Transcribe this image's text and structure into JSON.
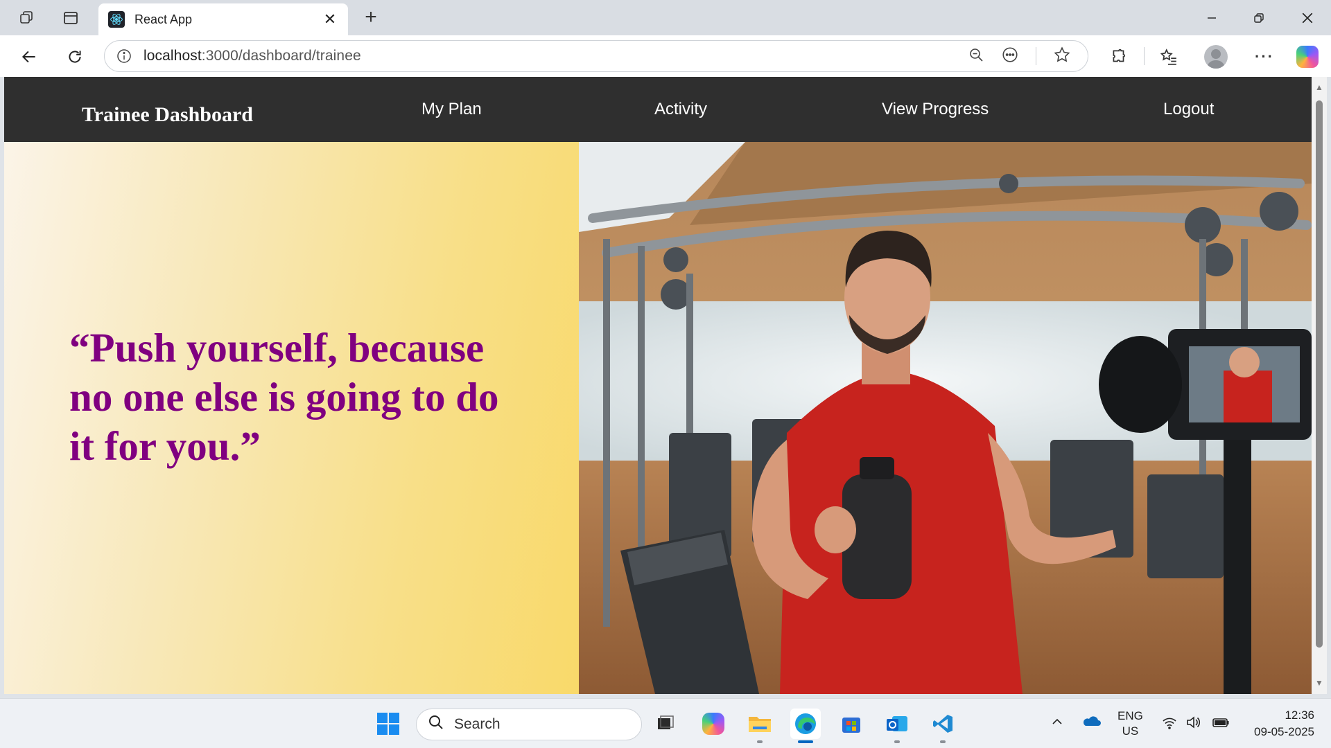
{
  "browser": {
    "tab_title": "React App",
    "url_host": "localhost",
    "url_path": ":3000/dashboard/trainee"
  },
  "app": {
    "brand": "Trainee Dashboard",
    "menu": [
      {
        "label": "My Plan"
      },
      {
        "label": "Activity"
      },
      {
        "label": "View Progress"
      },
      {
        "label": "Logout"
      }
    ],
    "quote": "“Push yourself, because no one else is going to do it for you.”",
    "colors": {
      "header_bg": "#2f2f2f",
      "quote_color": "#800080",
      "gradient_start": "#fbf4e8",
      "gradient_end": "#f9d96a"
    }
  },
  "hero_image": {
    "icon": "gym-trainer-photo"
  },
  "taskbar": {
    "search_placeholder": "Search",
    "lang_top": "ENG",
    "lang_bottom": "US",
    "time": "12:36",
    "date": "09-05-2025"
  }
}
